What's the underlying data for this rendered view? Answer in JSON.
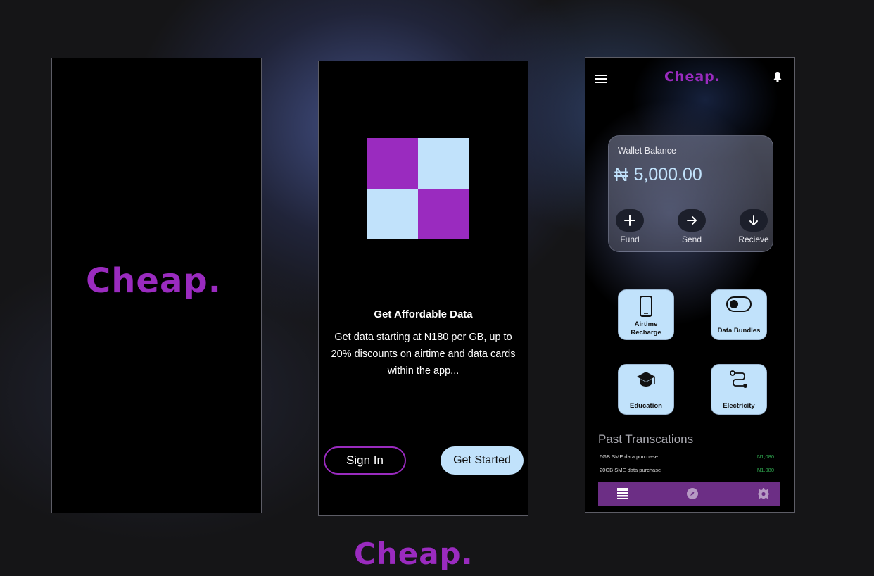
{
  "brand": {
    "logo_text": "Cheap.",
    "accent": "#9a2bbf",
    "light": "#c1e2fb"
  },
  "splash": {
    "logo": "Cheap."
  },
  "onboarding": {
    "title": "Get Affordable Data",
    "description": "Get data starting at N180 per GB, up to 20% discounts on airtime and data cards within the app...",
    "sign_in_label": "Sign In",
    "get_started_label": "Get Started"
  },
  "dashboard": {
    "header": {
      "logo": "Cheap.",
      "menu_icon": "menu-icon",
      "bell_icon": "bell-icon"
    },
    "wallet": {
      "label": "Wallet Balance",
      "currency_symbol": "₦",
      "amount": "5,000.00",
      "actions": [
        {
          "label": "Fund",
          "icon": "plus-icon"
        },
        {
          "label": "Send",
          "icon": "arrow-right-icon"
        },
        {
          "label": "Recieve",
          "icon": "arrow-down-icon"
        }
      ]
    },
    "services": [
      {
        "label": "Airtime Recharge",
        "icon": "phone-icon"
      },
      {
        "label": "Data Bundles",
        "icon": "toggle-icon"
      },
      {
        "label": "Education",
        "icon": "graduation-cap-icon"
      },
      {
        "label": "Electricity",
        "icon": "route-icon"
      }
    ],
    "past_title": "Past Transcations",
    "transactions": [
      {
        "name": "6GB SME data purchase",
        "amount": "N1,080"
      },
      {
        "name": "20GB SME data purchase",
        "amount": "N1,080"
      }
    ],
    "bottom_nav": [
      "list-icon",
      "compass-icon",
      "gear-icon"
    ]
  },
  "footer": {
    "logo": "Cheap."
  }
}
